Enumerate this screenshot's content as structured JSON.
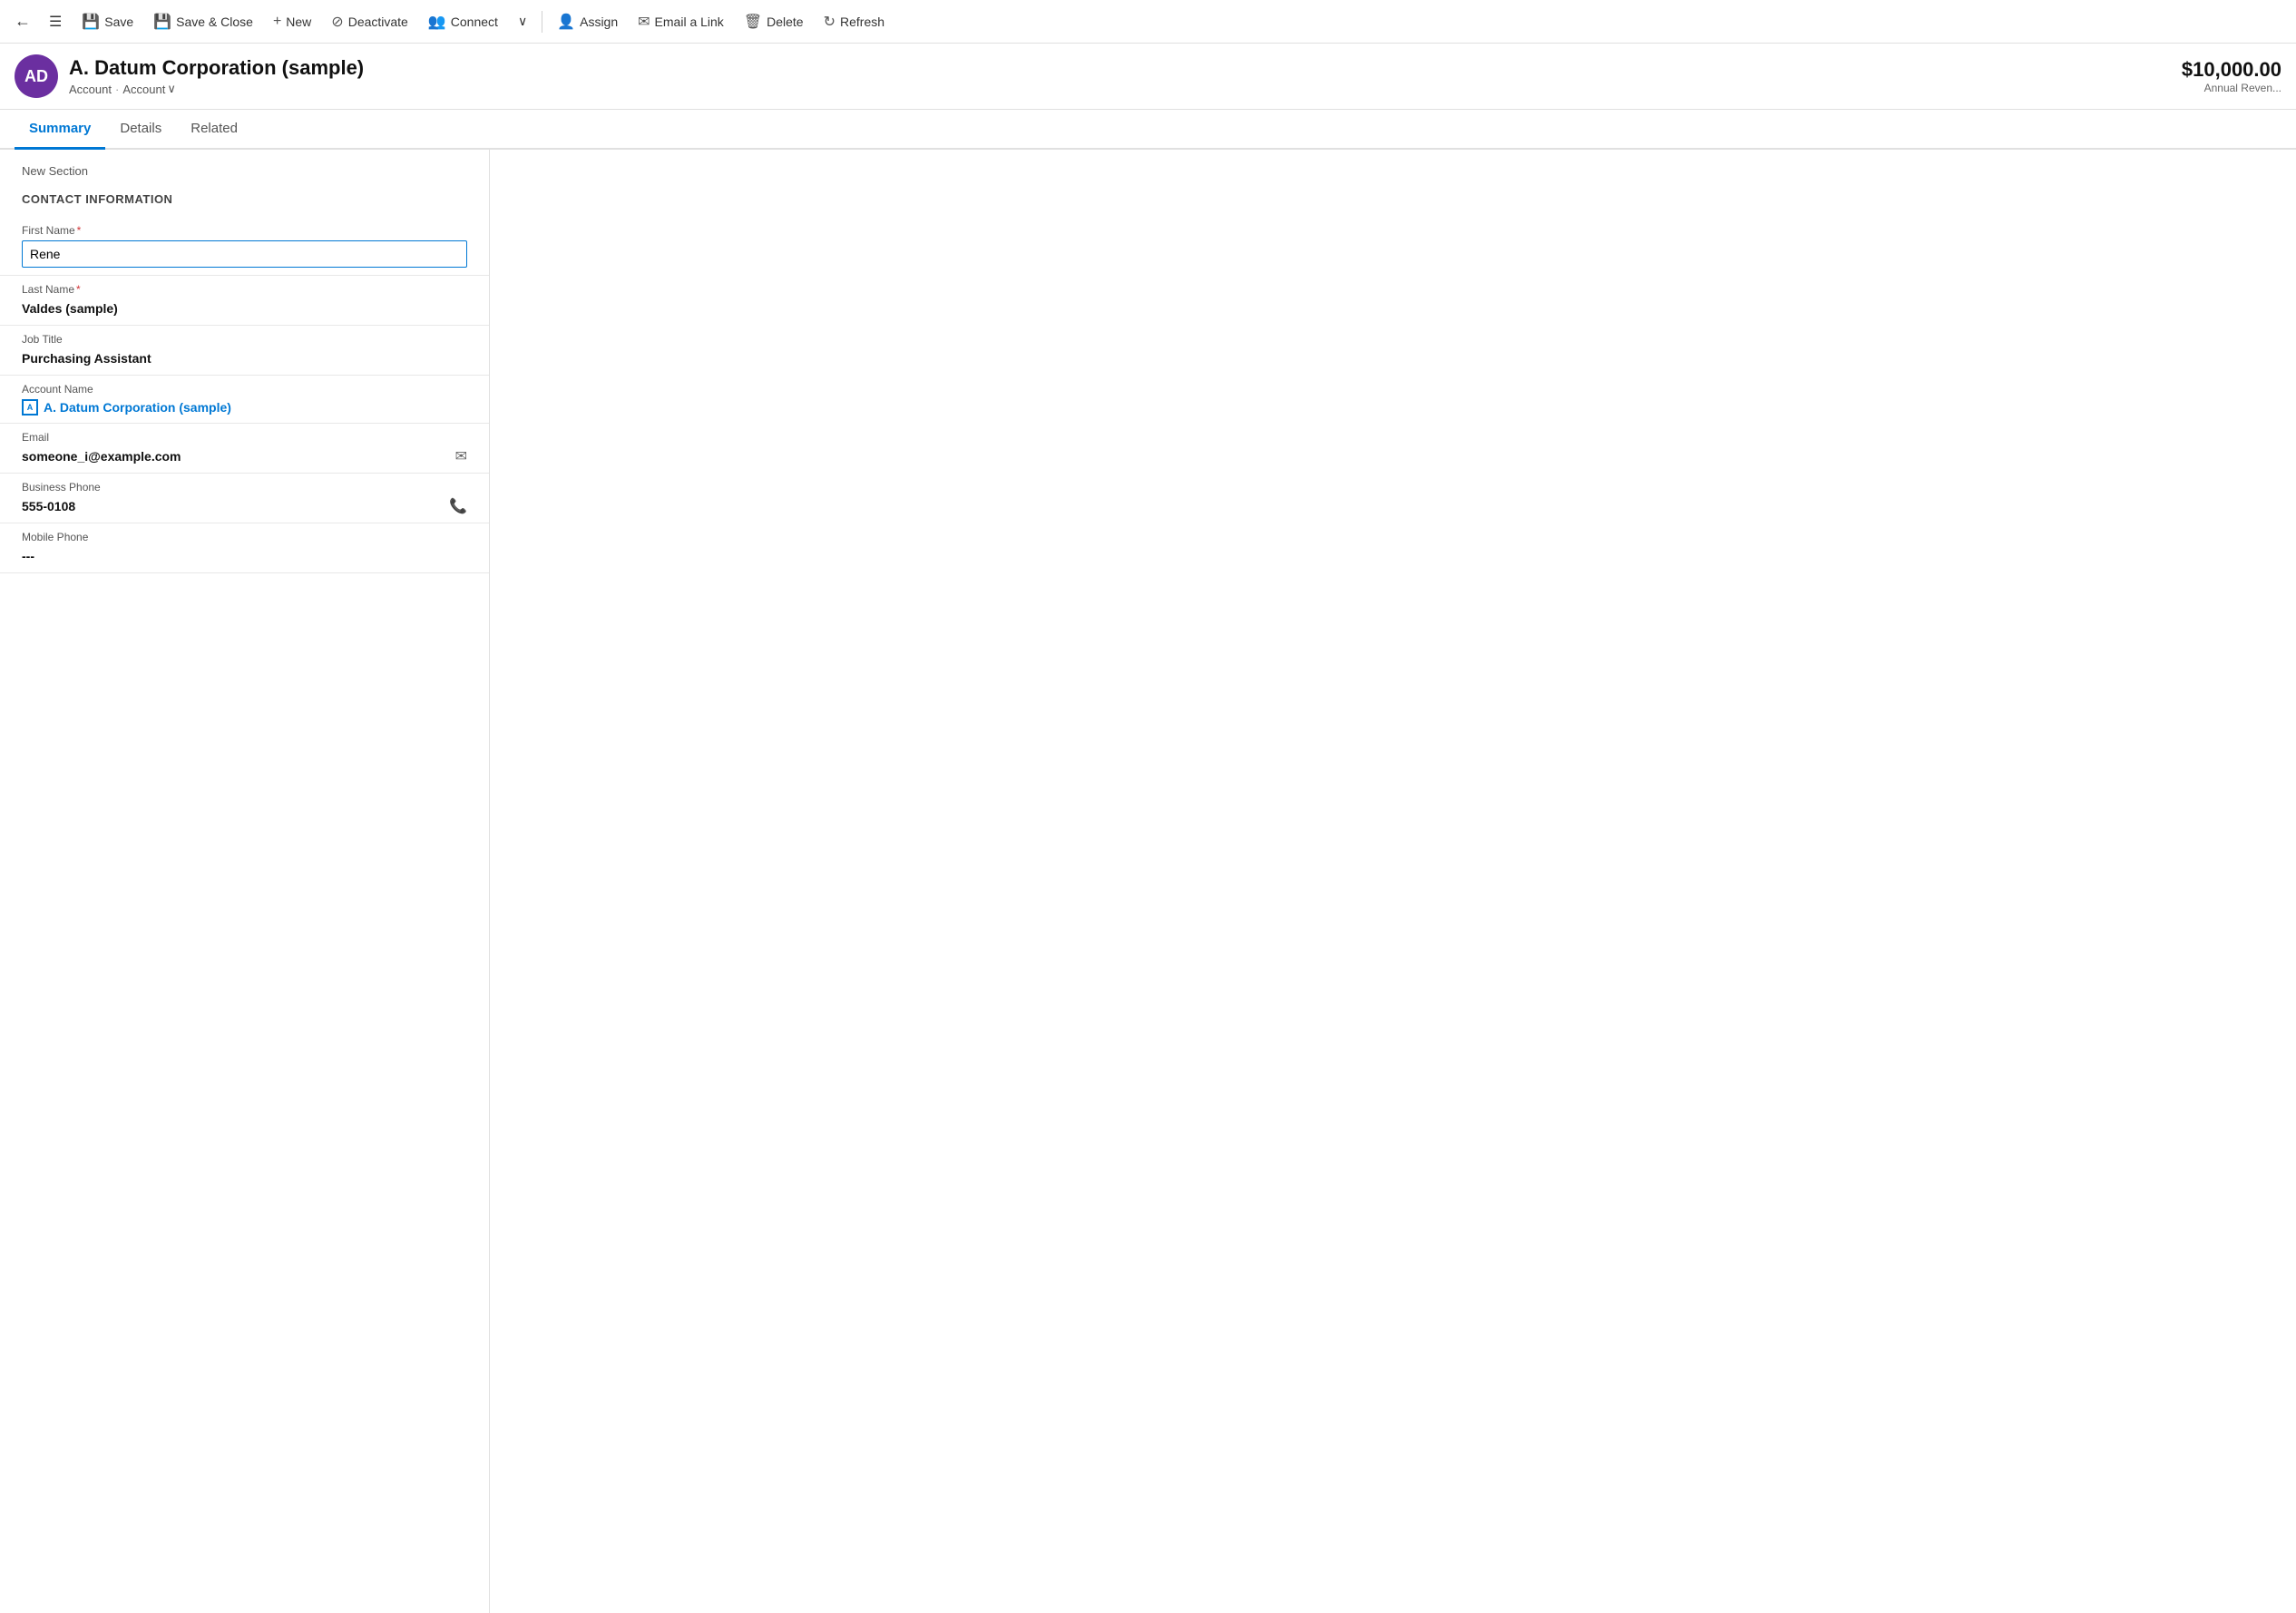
{
  "toolbar": {
    "back_icon": "←",
    "page_icon": "☰",
    "save_label": "Save",
    "save_close_label": "Save & Close",
    "new_label": "New",
    "deactivate_label": "Deactivate",
    "connect_label": "Connect",
    "more_icon": "⌄",
    "assign_label": "Assign",
    "email_link_label": "Email a Link",
    "delete_label": "Delete",
    "refresh_label": "Refresh"
  },
  "record": {
    "avatar_initials": "AD",
    "name": "A. Datum Corporation (sample)",
    "breadcrumb_type": "Account",
    "breadcrumb_subtype": "Account",
    "annual_revenue": "$10,000.00",
    "annual_revenue_label": "Annual Reven..."
  },
  "tabs": [
    {
      "id": "summary",
      "label": "Summary",
      "active": true
    },
    {
      "id": "details",
      "label": "Details",
      "active": false
    },
    {
      "id": "related",
      "label": "Related",
      "active": false
    }
  ],
  "form": {
    "section_header": "New Section",
    "section_title": "CONTACT INFORMATION",
    "fields": [
      {
        "id": "first_name",
        "label": "First Name",
        "required": true,
        "type": "input",
        "value": "Rene"
      },
      {
        "id": "last_name",
        "label": "Last Name",
        "required": true,
        "type": "text",
        "value": "Valdes (sample)"
      },
      {
        "id": "job_title",
        "label": "Job Title",
        "required": false,
        "type": "text",
        "value": "Purchasing Assistant"
      },
      {
        "id": "account_name",
        "label": "Account Name",
        "required": false,
        "type": "link",
        "value": "A. Datum Corporation (sample)"
      },
      {
        "id": "email",
        "label": "Email",
        "required": false,
        "type": "text_with_icon",
        "value": "someone_i@example.com"
      },
      {
        "id": "business_phone",
        "label": "Business Phone",
        "required": false,
        "type": "text_with_icon",
        "value": "555-0108"
      },
      {
        "id": "mobile_phone",
        "label": "Mobile Phone",
        "required": false,
        "type": "text",
        "value": "---"
      }
    ]
  },
  "icons": {
    "save": "💾",
    "save_close": "💾",
    "new": "+",
    "deactivate": "⊘",
    "connect": "👥",
    "assign": "👤",
    "email": "✉",
    "delete": "🗑",
    "refresh": "↻",
    "chevron_down": "∨",
    "email_action": "✉",
    "phone_action": "📞"
  }
}
